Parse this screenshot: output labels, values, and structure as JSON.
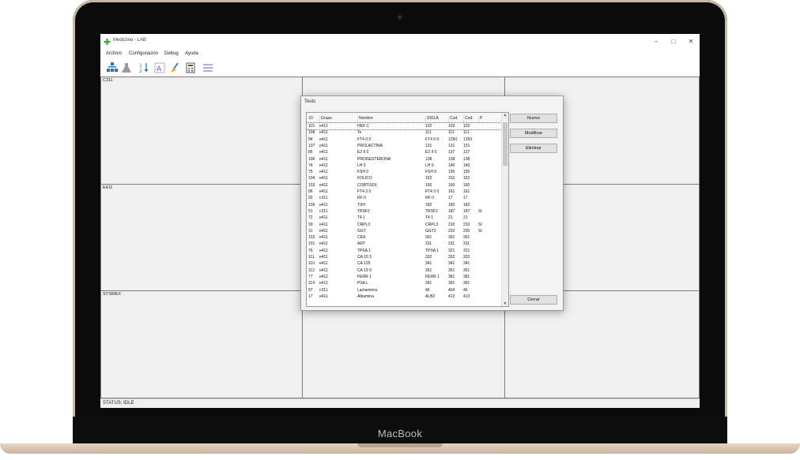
{
  "window": {
    "title": "Medicline - LAB",
    "minimize": "–",
    "maximize": "□",
    "close": "✕"
  },
  "device_brand": "MacBook",
  "menu": [
    "Archivo",
    "Configuracion",
    "Debug",
    "Ayuda"
  ],
  "toolbar_icons": [
    "network-icon",
    "flask-icon",
    "sort-icon",
    "font-icon",
    "broom-icon",
    "calculator-icon",
    "list-icon"
  ],
  "panes": {
    "top_left": "C311",
    "middle_left": "E411",
    "bottom_left": "SYSMEX"
  },
  "status": "STATUS: IDLE",
  "dialog": {
    "title": "Tests",
    "columns": [
      "ID",
      "Grupo",
      "Nombre",
      "SIGLA",
      "Cod.",
      "Cod.",
      "P"
    ],
    "rows": [
      [
        "115",
        "e411",
        "HEF C",
        "102",
        "102",
        "102",
        ""
      ],
      [
        "108",
        "e411",
        "Te",
        "111",
        "111",
        "111",
        ""
      ],
      [
        "84",
        "e411",
        "FT4 II 0",
        "FT4 II 0",
        "1250",
        "1250",
        ""
      ],
      [
        "107",
        "e411",
        "PROLACTINA",
        "131",
        "131",
        "131",
        ""
      ],
      [
        "85",
        "e411",
        "E2 II 0",
        "E2 II 0",
        "137",
        "137",
        ""
      ],
      [
        "106",
        "e411",
        "PROGESTERONA",
        "138",
        "138",
        "138",
        ""
      ],
      [
        "74",
        "e411",
        "LH 0",
        "LH 0",
        "140",
        "140",
        ""
      ],
      [
        "75",
        "e411",
        "FSH 0",
        "FSH 0",
        "150",
        "150",
        ""
      ],
      [
        "104",
        "e411",
        "FOLICO",
        "152",
        "152",
        "152",
        ""
      ],
      [
        "103",
        "e411",
        "CORTISOL",
        "160",
        "160",
        "160",
        ""
      ],
      [
        "86",
        "e411",
        "FT4 3 0",
        "FT4 3 0",
        "161",
        "161",
        ""
      ],
      [
        "92",
        "c311",
        "RF II",
        "RF II",
        "17",
        "17",
        ""
      ],
      [
        "109",
        "e411",
        "TSH",
        "182",
        "182",
        "182",
        ""
      ],
      [
        "51",
        "c311",
        "TRSF2",
        "TRSF2",
        "187",
        "187",
        "SI"
      ],
      [
        "72",
        "e411",
        "T4 1",
        "T4 1",
        "21",
        "21",
        ""
      ],
      [
        "30",
        "e411",
        "CRPL3",
        "CRPL3",
        "210",
        "210",
        "SI"
      ],
      [
        "31",
        "e411",
        "GGT",
        "GGT2",
        "220",
        "220",
        "SI"
      ],
      [
        "102",
        "e411",
        "CEA",
        "301",
        "301",
        "301",
        ""
      ],
      [
        "101",
        "e411",
        "AFP",
        "311",
        "311",
        "311",
        ""
      ],
      [
        "76",
        "e411",
        "TPSA 1",
        "TPSA 1",
        "321",
        "321",
        ""
      ],
      [
        "111",
        "e411",
        "CA 15 3",
        "332",
        "332",
        "332",
        ""
      ],
      [
        "110",
        "e411",
        "CA 125",
        "341",
        "341",
        "341",
        ""
      ],
      [
        "112",
        "e411",
        "CA 19 9",
        "351",
        "351",
        "351",
        ""
      ],
      [
        "77",
        "e411",
        "FERR 1",
        "FERR 1",
        "381",
        "381",
        ""
      ],
      [
        "114",
        "e411",
        "PSA L",
        "391",
        "391",
        "391",
        ""
      ],
      [
        "97",
        "c311",
        "Lactaminos",
        "40",
        "404",
        "40",
        ""
      ],
      [
        "17",
        "e411",
        "Albumina",
        "ALB2",
        "413",
        "413",
        ""
      ]
    ],
    "buttons": {
      "nuevo": "Nuevo",
      "modificar": "Modificar",
      "eliminar": "Eliminar",
      "cerrar": "Cerrar"
    }
  }
}
